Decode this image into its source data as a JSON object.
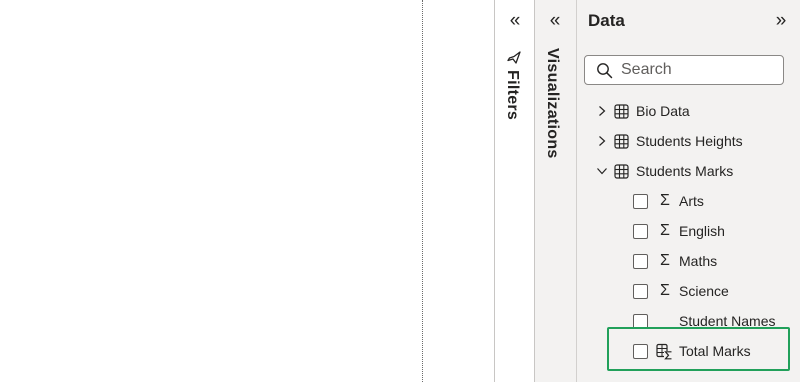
{
  "filters_pane": {
    "collapse_glyph": "«",
    "label": "Filters",
    "icon": "filter-icon"
  },
  "visualizations_pane": {
    "collapse_glyph": "«",
    "label": "Visualizations"
  },
  "data_pane": {
    "title": "Data",
    "expand_glyph": "»",
    "search": {
      "placeholder": "Search",
      "value": ""
    },
    "tables": [
      {
        "name": "Bio Data",
        "expanded": false,
        "icon": "table-icon"
      },
      {
        "name": "Students Heights",
        "expanded": false,
        "icon": "table-icon"
      },
      {
        "name": "Students Marks",
        "expanded": true,
        "icon": "table-icon",
        "fields": [
          {
            "name": "Arts",
            "icon": "sigma-icon",
            "glyph": "Σ",
            "checked": false
          },
          {
            "name": "English",
            "icon": "sigma-icon",
            "glyph": "Σ",
            "checked": false
          },
          {
            "name": "Maths",
            "icon": "sigma-icon",
            "glyph": "Σ",
            "checked": false
          },
          {
            "name": "Science",
            "icon": "sigma-icon",
            "glyph": "Σ",
            "checked": false
          },
          {
            "name": "Student Names",
            "icon": "",
            "checked": false
          },
          {
            "name": "Total Marks",
            "icon": "calculated-column-icon",
            "checked": false,
            "highlighted": true
          }
        ]
      }
    ]
  },
  "colors": {
    "pane_bg": "#f3f2f1",
    "highlight": "#21a05a",
    "text": "#252423"
  }
}
